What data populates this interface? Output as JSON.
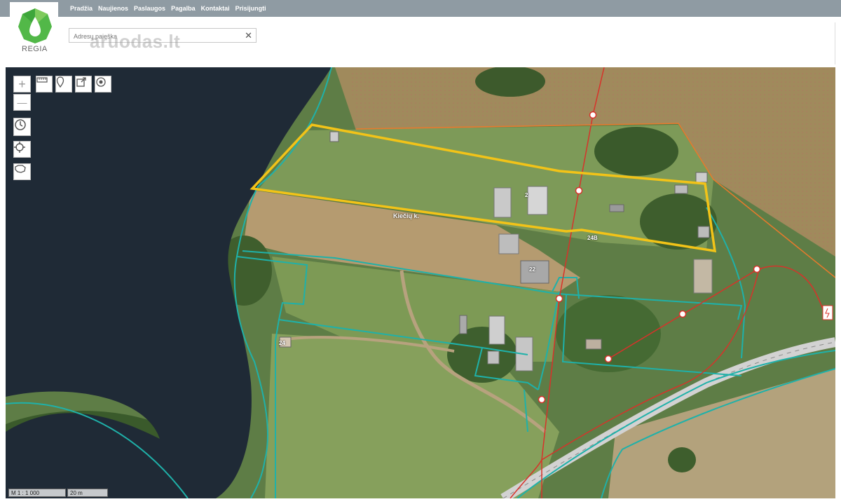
{
  "nav": {
    "items": [
      "Pradžia",
      "Naujienos",
      "Paslaugos",
      "Pagalba",
      "Kontaktai",
      "Prisijungti"
    ]
  },
  "logo": {
    "text": "REGIA"
  },
  "watermark": {
    "text": "aruodas.lt"
  },
  "search": {
    "placeholder": "Adresų paieška",
    "clear_label": "✕"
  },
  "map": {
    "place_label": "Kiečių k.",
    "house_numbers": [
      "2",
      "24B",
      "22",
      "24"
    ],
    "scale_ratio": "M 1 : 1 000",
    "scale_bar": "20 m",
    "colors": {
      "parcel_highlight": "#f2c318",
      "cadastral_lines": "#1fb1a9",
      "power_lines": "#d8322a",
      "water": "#1f2a36",
      "road": "#dadada"
    }
  },
  "toolbar": {
    "zoom_in": "+",
    "zoom_out": "—",
    "tools": [
      "measure-icon",
      "marker-icon",
      "export-icon",
      "target-icon"
    ],
    "side": [
      "history-icon",
      "locate-icon",
      "lithuania-map-icon"
    ]
  }
}
